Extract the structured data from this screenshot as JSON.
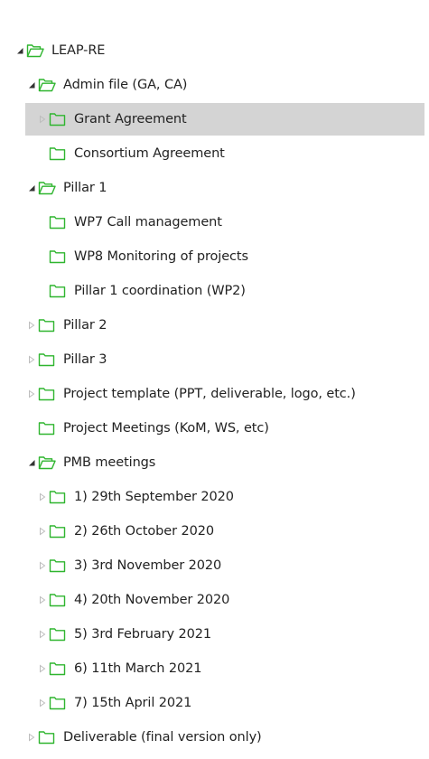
{
  "colors": {
    "folder_green": "#2fb52f",
    "expander_dark": "#333333",
    "expander_light": "#bdbdbd",
    "selected_bg": "#d4d4d4"
  },
  "icons": {
    "expanded": "triangle-expanded-icon",
    "collapsed": "triangle-collapsed-icon",
    "folder_open": "folder-open-icon",
    "folder_closed": "folder-icon"
  },
  "tree": [
    {
      "label": "LEAP-RE",
      "depth": 0,
      "toggle": "expanded",
      "folder": "open",
      "selected": false
    },
    {
      "label": "Admin file (GA, CA)",
      "depth": 1,
      "toggle": "expanded",
      "folder": "open",
      "selected": false
    },
    {
      "label": "Grant Agreement",
      "depth": 2,
      "toggle": "collapsed",
      "folder": "closed",
      "selected": true
    },
    {
      "label": "Consortium Agreement",
      "depth": 2,
      "toggle": "none",
      "folder": "closed",
      "selected": false
    },
    {
      "label": "Pillar 1",
      "depth": 1,
      "toggle": "expanded",
      "folder": "open",
      "selected": false
    },
    {
      "label": "WP7 Call management",
      "depth": 2,
      "toggle": "none",
      "folder": "closed",
      "selected": false
    },
    {
      "label": "WP8 Monitoring of projects",
      "depth": 2,
      "toggle": "none",
      "folder": "closed",
      "selected": false
    },
    {
      "label": "Pillar 1 coordination (WP2)",
      "depth": 2,
      "toggle": "none",
      "folder": "closed",
      "selected": false
    },
    {
      "label": "Pillar 2",
      "depth": 1,
      "toggle": "collapsed",
      "folder": "closed",
      "selected": false
    },
    {
      "label": "Pillar 3",
      "depth": 1,
      "toggle": "collapsed",
      "folder": "closed",
      "selected": false
    },
    {
      "label": "Project template (PPT, deliverable, logo, etc.)",
      "depth": 1,
      "toggle": "collapsed",
      "folder": "closed",
      "selected": false
    },
    {
      "label": "Project Meetings (KoM, WS, etc)",
      "depth": 1,
      "toggle": "none",
      "folder": "closed",
      "selected": false
    },
    {
      "label": "PMB meetings",
      "depth": 1,
      "toggle": "expanded",
      "folder": "open",
      "selected": false
    },
    {
      "label": "1) 29th September 2020",
      "depth": 2,
      "toggle": "collapsed",
      "folder": "closed",
      "selected": false
    },
    {
      "label": "2) 26th October 2020",
      "depth": 2,
      "toggle": "collapsed",
      "folder": "closed",
      "selected": false
    },
    {
      "label": "3) 3rd November 2020",
      "depth": 2,
      "toggle": "collapsed",
      "folder": "closed",
      "selected": false
    },
    {
      "label": "4) 20th November 2020",
      "depth": 2,
      "toggle": "collapsed",
      "folder": "closed",
      "selected": false
    },
    {
      "label": "5) 3rd February 2021",
      "depth": 2,
      "toggle": "collapsed",
      "folder": "closed",
      "selected": false
    },
    {
      "label": "6) 11th March 2021",
      "depth": 2,
      "toggle": "collapsed",
      "folder": "closed",
      "selected": false
    },
    {
      "label": "7) 15th April 2021",
      "depth": 2,
      "toggle": "collapsed",
      "folder": "closed",
      "selected": false
    },
    {
      "label": "Deliverable (final version only)",
      "depth": 1,
      "toggle": "collapsed",
      "folder": "closed",
      "selected": false
    }
  ]
}
